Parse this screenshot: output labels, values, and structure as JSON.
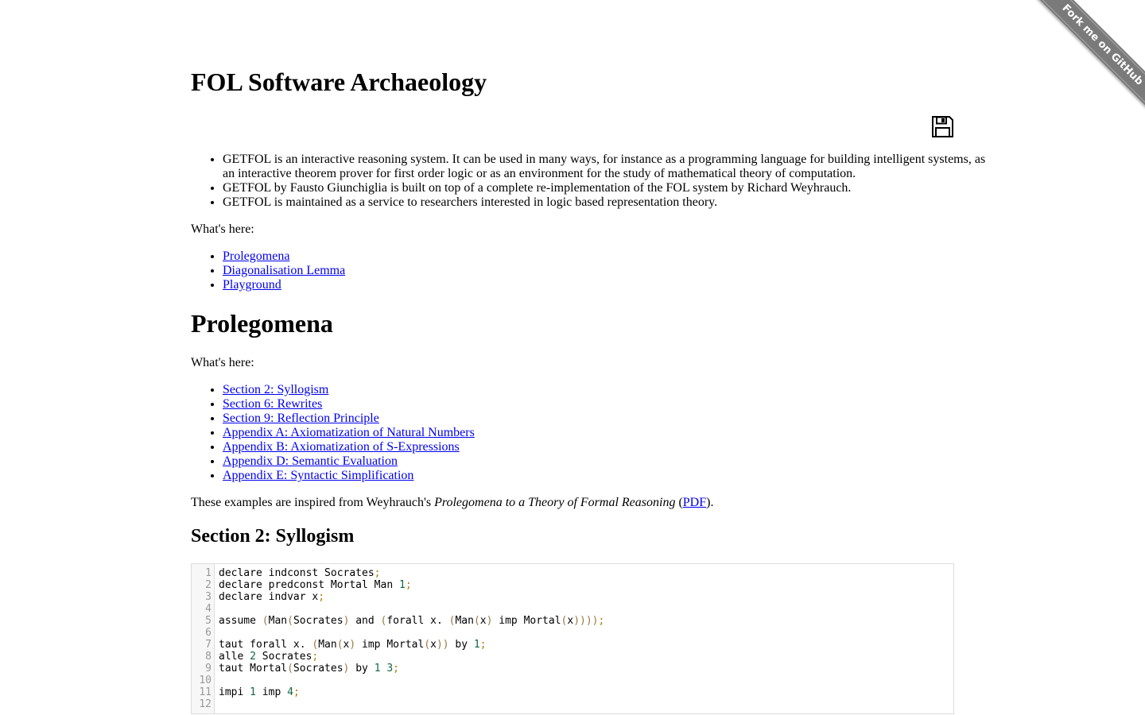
{
  "ribbon": {
    "label": "Fork me on GitHub"
  },
  "title": "FOL Software Archaeology",
  "save_icon": "floppy-disk-icon",
  "intro": [
    "GETFOL is an interactive reasoning system. It can be used in many ways, for instance as a programming language for building intelligent systems, as an interactive theorem prover for first order logic or as an environment for the study of mathematical theory of computation.",
    "GETFOL by Fausto Giunchiglia is built on top of a complete re-implementation of the FOL system by Richard Weyhrauch.",
    "GETFOL is maintained as a service to researchers interested in logic based representation theory."
  ],
  "whats_here_label": "What's here:",
  "toc": [
    "Prolegomena",
    "Diagonalisation Lemma",
    "Playground"
  ],
  "prolegomena": {
    "heading": "Prolegomena",
    "whats_here_label": "What's here:",
    "sections": [
      "Section 2: Syllogism",
      "Section 6: Rewrites",
      "Section 9: Reflection Principle",
      "Appendix A: Axiomatization of Natural Numbers",
      "Appendix B: Axiomatization of S-Expressions",
      "Appendix D: Semantic Evaluation",
      "Appendix E: Syntactic Simplification"
    ],
    "inspired_prefix": "These examples are inspired from Weyhrauch's ",
    "inspired_title": "Prolegomena to a Theory of Formal Reasoning",
    "inspired_open": " (",
    "inspired_link": "PDF",
    "inspired_close": ")."
  },
  "syllogism": {
    "heading": "Section 2: Syllogism",
    "line_numbers": [
      "1",
      "2",
      "3",
      "4",
      "5",
      "6",
      "7",
      "8",
      "9",
      "10",
      "11",
      "12"
    ],
    "code_lines": [
      "declare indconst Socrates;",
      "declare predconst Mortal Man 1;",
      "declare indvar x;",
      "",
      "assume (Man(Socrates) and (forall x. (Man(x) imp Mortal(x))));",
      "",
      "taut forall x. (Man(x) imp Mortal(x)) by 1;",
      "alle 2 Socrates;",
      "taut Mortal(Socrates) by 1 3;",
      "",
      "impi 1 imp 4;",
      ""
    ],
    "colors": {
      "number": "#116644",
      "semicolon": "#b07a00",
      "paren": "#997744"
    }
  }
}
